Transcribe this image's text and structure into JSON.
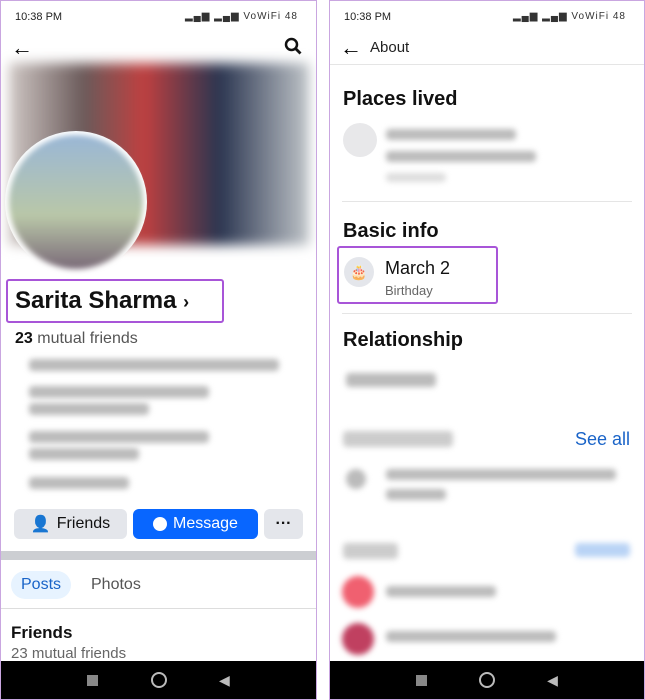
{
  "left": {
    "status_time": "10:38 PM",
    "status_icons": "▂▄▆ ▂▄▆ VoWiFi 48",
    "profile_name": "Sarita Sharma",
    "mutual_count": "23",
    "mutual_label": "mutual friends",
    "buttons": {
      "friends": "Friends",
      "message": "Message",
      "more": "···"
    },
    "tabs": [
      {
        "label": "Posts",
        "active": true
      },
      {
        "label": "Photos",
        "active": false
      }
    ],
    "friends_section": {
      "title": "Friends",
      "subtitle": "23 mutual friends"
    }
  },
  "right": {
    "status_time": "10:38 PM",
    "status_icons": "▂▄▆ ▂▄▆ VoWiFi 48",
    "header_title": "About",
    "sections": {
      "places": "Places lived",
      "basic": "Basic info",
      "relationship": "Relationship"
    },
    "birthday": {
      "value": "March 2",
      "label": "Birthday"
    },
    "see_all": "See all"
  },
  "colors": {
    "accent": "#0866ff",
    "highlight": "#a855d8"
  }
}
